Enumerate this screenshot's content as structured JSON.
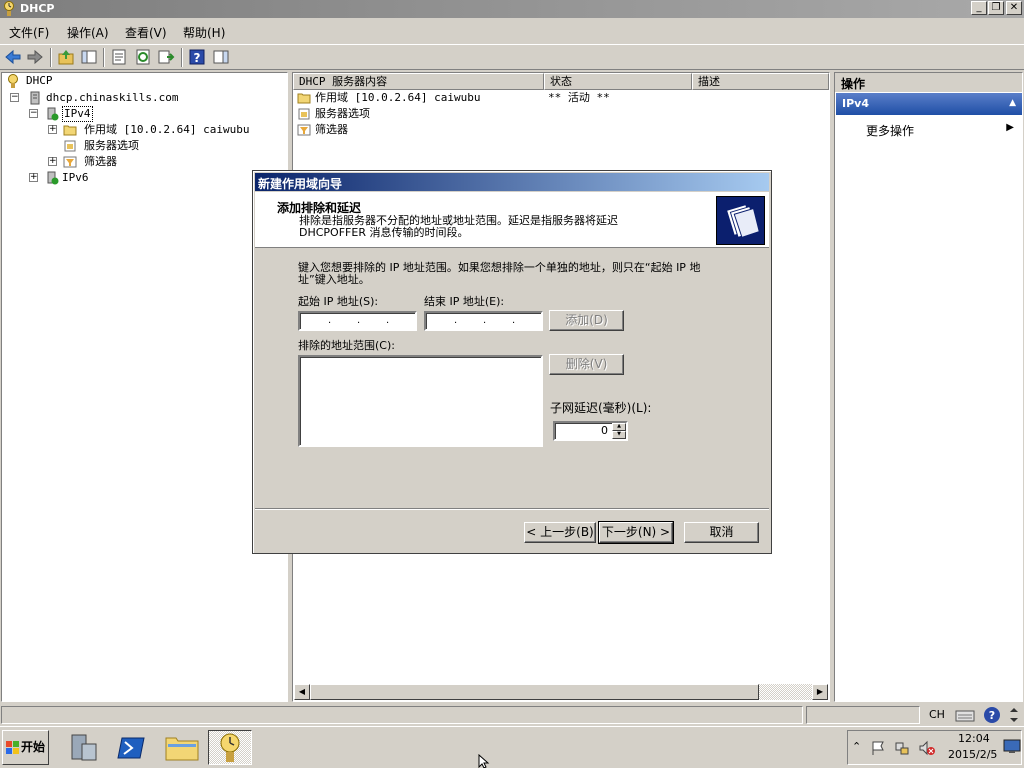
{
  "window": {
    "title": "DHCP",
    "controls": {
      "minimize": "_",
      "restore": "❐",
      "close": "✕"
    }
  },
  "menu": [
    "文件(F)",
    "操作(A)",
    "查看(V)",
    "帮助(H)"
  ],
  "tree": {
    "root": "DHCP",
    "server": "dhcp.chinaskills.com",
    "ipv4": "IPv4",
    "scope": "作用域 [10.0.2.64] caiwubu",
    "server_options": "服务器选项",
    "filters": "筛选器",
    "ipv6": "IPv6"
  },
  "list": {
    "columns": [
      "DHCP 服务器内容",
      "状态",
      "描述"
    ],
    "rows": [
      {
        "name": "作用域 [10.0.2.64] caiwubu",
        "status": "** 活动 **",
        "desc": ""
      },
      {
        "name": "服务器选项",
        "status": "",
        "desc": ""
      },
      {
        "name": "筛选器",
        "status": "",
        "desc": ""
      }
    ]
  },
  "actions": {
    "header": "操作",
    "group": "IPv4",
    "more": "更多操作"
  },
  "dialog": {
    "title": "新建作用域向导",
    "step_title": "添加排除和延迟",
    "step_desc": "排除是指服务器不分配的地址或地址范围。延迟是指服务器将延迟 DHCPOFFER 消息传输的时间段。",
    "instructions": "键入您想要排除的 IP 地址范围。如果您想排除一个单独的地址，则只在“起始 IP 地址”键入地址。",
    "start_ip_label": "起始 IP 地址(S):",
    "end_ip_label": "结束 IP 地址(E):",
    "start_ip_value": "",
    "end_ip_value": "",
    "add_button": "添加(D)",
    "excluded_label": "排除的地址范围(C):",
    "excluded_items": [],
    "delete_button": "删除(V)",
    "delay_label": "子网延迟(毫秒)(L):",
    "delay_value": "0",
    "back_button": "< 上一步(B)",
    "next_button": "下一步(N) >",
    "cancel_button": "取消"
  },
  "statusbar": {
    "ime": "CH"
  },
  "taskbar": {
    "start": "开始",
    "time": "12:04",
    "date": "2015/2/5"
  },
  "colors": {
    "title_active": "#0a246a",
    "actions_group": "#1f4fa6",
    "chrome": "#d4d0c8"
  }
}
